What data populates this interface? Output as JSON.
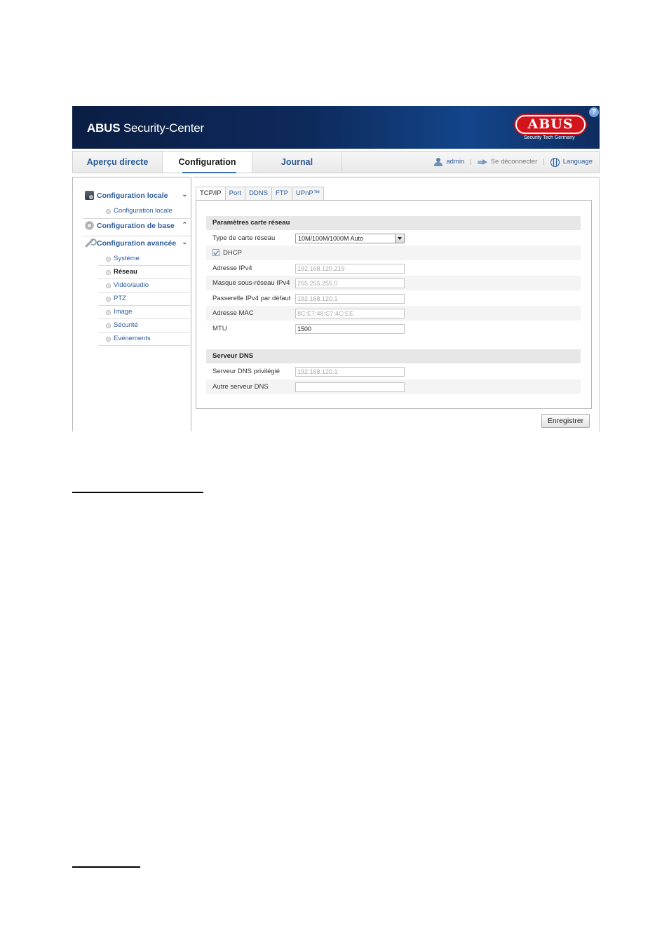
{
  "banner": {
    "title_bold": "ABUS",
    "title_rest": " Security-Center",
    "logo_text": "ABUS",
    "logo_tagline": "Security Tech Germany",
    "help_label": "?"
  },
  "topnav": {
    "tabs": [
      {
        "label": "Aperçu directe",
        "active": false
      },
      {
        "label": "Configuration",
        "active": true
      },
      {
        "label": "Journal",
        "active": false
      }
    ],
    "user": "admin",
    "logout": "Se déconnecter",
    "language": "Language",
    "separator": "|"
  },
  "sidebar": {
    "groups": [
      {
        "label": "Configuration locale",
        "icon": "monitor-icon",
        "chevron": "⌄",
        "items": [
          {
            "label": "Configuration locale"
          }
        ]
      },
      {
        "label": "Configuration de base",
        "icon": "gear-icon",
        "chevron": "⌃",
        "items": []
      },
      {
        "label": "Configuration avancée",
        "icon": "wrench-icon",
        "chevron": "⌄",
        "items": [
          {
            "label": "Système"
          },
          {
            "label": "Réseau",
            "active": true
          },
          {
            "label": "Vidéo/audio"
          },
          {
            "label": "PTZ"
          },
          {
            "label": "Image"
          },
          {
            "label": "Sécurité"
          },
          {
            "label": "Evénements"
          }
        ]
      }
    ]
  },
  "subtabs": [
    "TCP/IP",
    "Port",
    "DDNS",
    "FTP",
    "UPnP™"
  ],
  "network": {
    "section_title": "Paramètres carte réseau",
    "nic_type_label": "Type de carte réseau",
    "nic_type_value": "10M/100M/1000M Auto",
    "dhcp_label": "DHCP",
    "dhcp_checked": true,
    "ipv4_label": "Adresse IPv4",
    "ipv4_value": "192.168.120.219",
    "mask_label": "Masque sous-réseau IPv4",
    "mask_value": "255.255.255.0",
    "gateway_label": "Passerelle IPv4 par défaut",
    "gateway_value": "192.168.120.1",
    "mac_label": "Adresse MAC",
    "mac_value": "8C:E7:48:C7:4C:EE",
    "mtu_label": "MTU",
    "mtu_value": "1500"
  },
  "dns": {
    "section_title": "Serveur DNS",
    "preferred_label": "Serveur DNS privilégié",
    "preferred_value": "192.168.120.1",
    "alternate_label": "Autre serveur DNS",
    "alternate_value": ""
  },
  "actions": {
    "save_label": "Enregistrer"
  }
}
